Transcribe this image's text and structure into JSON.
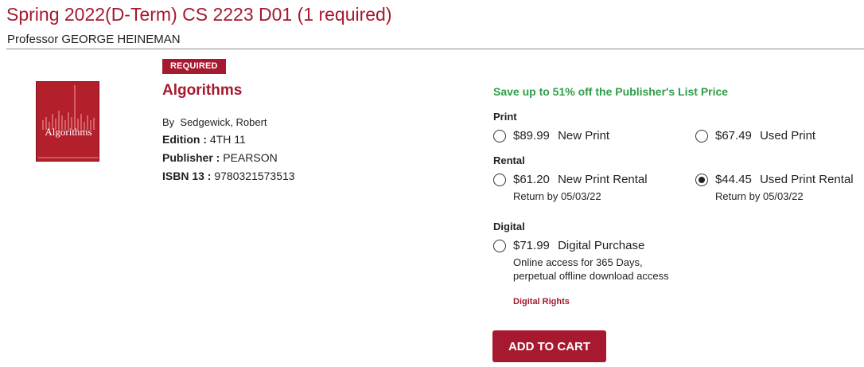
{
  "course": {
    "title": "Spring 2022(D-Term) CS 2223 D01 (1 required)",
    "professor": "Professor GEORGE HEINEMAN"
  },
  "book": {
    "badge": "REQUIRED",
    "cover_title": "Algorithms",
    "title": "Algorithms",
    "author_prefix": "By",
    "author": "Sedgewick, Robert",
    "edition_label": "Edition :",
    "edition": "4TH 11",
    "publisher_label": "Publisher :",
    "publisher": "PEARSON",
    "isbn_label": "ISBN 13 :",
    "isbn": "9780321573513"
  },
  "pricing": {
    "save_text": "Save up to 51% off the Publisher's List Price",
    "print_label": "Print",
    "rental_label": "Rental",
    "digital_label": "Digital",
    "options": {
      "new_print": {
        "price": "$89.99",
        "label": "New Print",
        "selected": false
      },
      "used_print": {
        "price": "$67.49",
        "label": "Used Print",
        "selected": false
      },
      "new_rental": {
        "price": "$61.20",
        "label": "New Print Rental",
        "note": "Return by 05/03/22",
        "selected": false
      },
      "used_rental": {
        "price": "$44.45",
        "label": "Used Print Rental",
        "note": "Return by 05/03/22",
        "selected": true
      },
      "digital": {
        "price": "$71.99",
        "label": "Digital Purchase",
        "note1": "Online access for 365 Days,",
        "note2": "perpetual offline download access",
        "selected": false
      }
    },
    "digital_rights": "Digital Rights",
    "add_to_cart": "ADD TO CART"
  },
  "colors": {
    "brand": "#a6192e",
    "save_green": "#2e9e47"
  }
}
